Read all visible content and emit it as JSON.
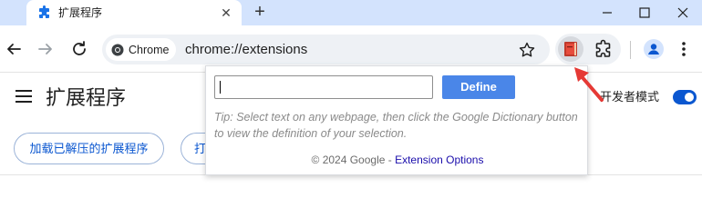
{
  "browser": {
    "tab": {
      "title": "扩展程序",
      "close_glyph": "✕"
    },
    "new_tab_glyph": "+",
    "omnibox": {
      "site_chip": "Chrome",
      "url": "chrome://extensions"
    }
  },
  "page": {
    "title": "扩展程序",
    "developer_mode_label": "开发者模式",
    "developer_mode_on": true,
    "buttons": {
      "load_unpacked": "加载已解压的扩展程序",
      "pack_partial": "打"
    }
  },
  "popup": {
    "input_value": "",
    "define_label": "Define",
    "tip": "Tip: Select text on any webpage, then click the Google Dictionary button to view the definition of your selection.",
    "footer_prefix": "© 2024 Google - ",
    "footer_link": "Extension Options"
  },
  "colors": {
    "accent": "#0b57d0",
    "define_button": "#4a86e8",
    "annotation_arrow": "#e53935"
  },
  "icons": {
    "tab_favicon": "puzzle-icon",
    "back": "arrow-left-icon",
    "forward": "arrow-right-icon",
    "reload": "reload-icon",
    "bookmark": "star-icon",
    "extension_action": "dictionary-book-icon",
    "extensions_menu": "puzzle-icon",
    "profile": "person-icon",
    "menu": "kebab-icon"
  }
}
